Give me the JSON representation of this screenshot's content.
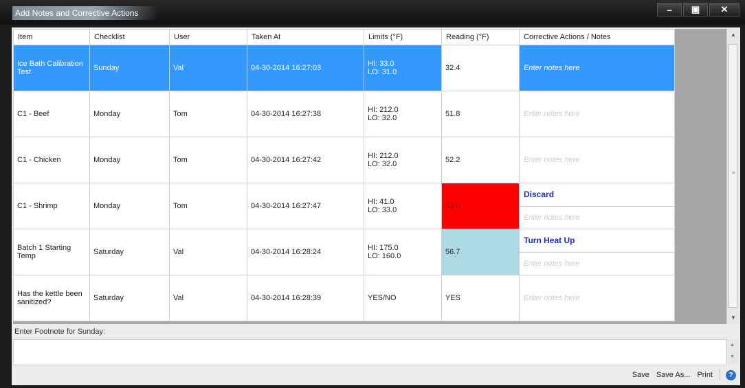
{
  "window": {
    "title": "Add Notes and Corrective Actions",
    "controls": {
      "minimize": "–",
      "maximize": "▣",
      "close": "✕"
    }
  },
  "table": {
    "columns": [
      "Item",
      "Checklist",
      "User",
      "Taken At",
      "Limits (°F)",
      "Reading (°F)",
      "Corrective Actions / Notes"
    ],
    "rows": [
      {
        "item": "Ice Bath Calibration Test",
        "checklist": "Sunday",
        "user": "Val",
        "taken_at": "04-30-2014 16:27:03",
        "limit_hi": "HI: 33.0",
        "limit_lo": "LO: 31.0",
        "reading": "32.4",
        "note": "Enter notes here"
      },
      {
        "item": "C1 - Beef",
        "checklist": "Monday",
        "user": "Tom",
        "taken_at": "04-30-2014 16:27:38",
        "limit_hi": "HI: 212.0",
        "limit_lo": "LO: 32.0",
        "reading": "51.8",
        "note": "Enter notes here"
      },
      {
        "item": "C1 - Chicken",
        "checklist": "Monday",
        "user": "Tom",
        "taken_at": "04-30-2014 16:27:42",
        "limit_hi": "HI: 212.0",
        "limit_lo": "LO: 32.0",
        "reading": "52.2",
        "note": "Enter notes here"
      },
      {
        "item": "C1 - Shrimp",
        "checklist": "Monday",
        "user": "Tom",
        "taken_at": "04-30-2014 16:27:47",
        "limit_hi": "HI: 41.0",
        "limit_lo": "LO: 33.0",
        "reading": "53.0",
        "action": "Discard",
        "note": "Enter notes here"
      },
      {
        "item": "Batch 1 Starting Temp",
        "checklist": "Saturday",
        "user": "Val",
        "taken_at": "04-30-2014 16:28:24",
        "limit_hi": "HI: 175.0",
        "limit_lo": "LO: 160.0",
        "reading": "56.7",
        "action": "Turn Heat Up",
        "note": "Enter notes here"
      },
      {
        "item": "Has the kettle been sanitized?",
        "checklist": "Saturday",
        "user": "Val",
        "taken_at": "04-30-2014 16:28:39",
        "limit": "YES/NO",
        "reading": "YES",
        "note": "Enter notes here"
      }
    ]
  },
  "footnote": {
    "label": "Enter Footnote for Sunday:"
  },
  "bottom_bar": {
    "save": "Save",
    "save_as": "Save As...",
    "print": "Print",
    "help": "?"
  },
  "colors": {
    "selected_row": "#3399ff",
    "alert_high": "#ff0000",
    "alert_low": "#add8e6",
    "action_text": "#1a2bd6"
  }
}
